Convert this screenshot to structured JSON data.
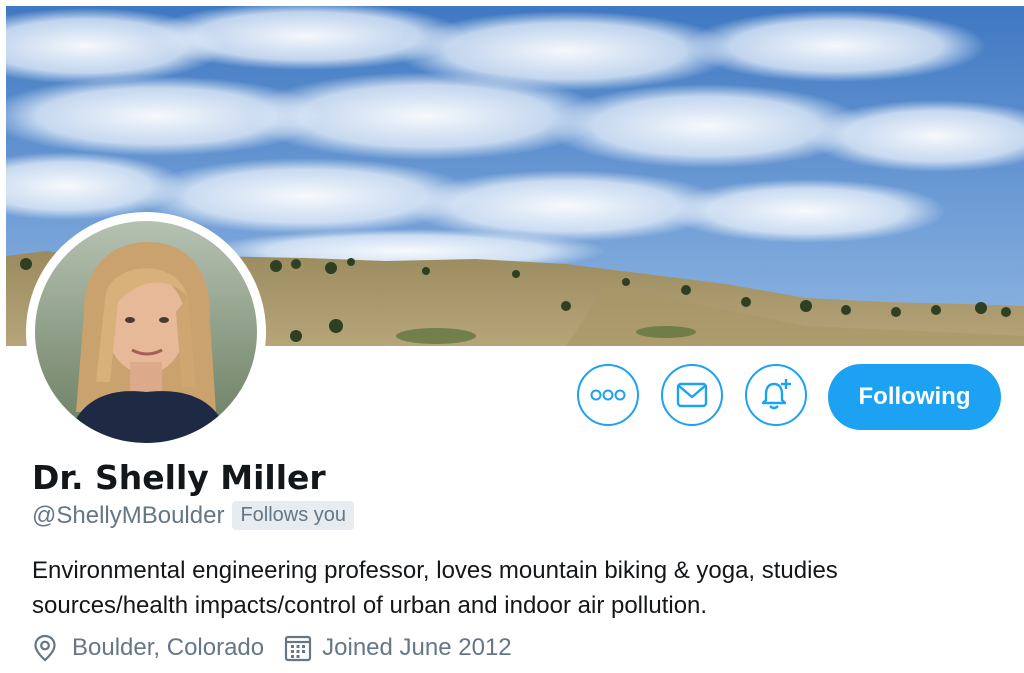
{
  "profile": {
    "name": "Dr. Shelly Miller",
    "handle": "@ShellyMBoulder",
    "follows_you_badge": "Follows you",
    "bio": "Environmental engineering professor, loves mountain biking & yoga, studies sources/health impacts/control of urban and indoor air pollution.",
    "location": "Boulder, Colorado",
    "joined": "Joined June 2012"
  },
  "actions": {
    "more_icon": "more-dots-icon",
    "message_icon": "envelope-icon",
    "notify_icon": "bell-plus-icon",
    "follow_label": "Following"
  },
  "colors": {
    "accent": "#1da1f2",
    "secondary_text": "#657786",
    "badge_bg": "#e6ecf0"
  }
}
